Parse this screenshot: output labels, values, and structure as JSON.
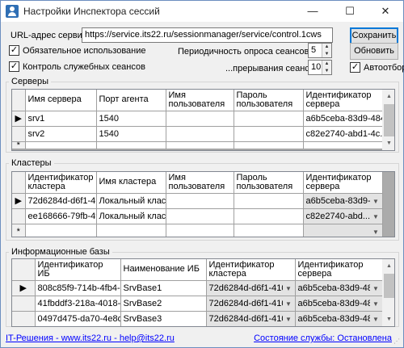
{
  "window": {
    "title": "Настройки Инспектора сессий",
    "minimize": "—",
    "maximize": "☐",
    "close": "✕"
  },
  "form": {
    "url_label": "URL-адрес сервиса:",
    "url_value": "https://service.its22.ru/sessionmanager/service/control.1cws",
    "save_label": "Сохранить",
    "refresh_label": "Обновить",
    "mandatory_label": "Обязательное использование",
    "mandatory_checked": true,
    "service_sessions_label": "Контроль служебных сеансов",
    "service_sessions_checked": true,
    "poll_label": "Периодичность опроса сеансов, сек.:",
    "poll_value": "5",
    "interrupt_label": "...прерывания сеансов:",
    "interrupt_value": "10",
    "autoselect_label": "Автоотбор",
    "autoselect_checked": true
  },
  "servers": {
    "title": "Серверы",
    "columns": [
      "Имя сервера",
      "Порт агента",
      "Имя пользователя",
      "Пароль пользователя",
      "Идентификатор сервера"
    ],
    "rows": [
      [
        "srv1",
        "1540",
        "",
        "",
        "a6b5ceba-83d9-484..."
      ],
      [
        "srv2",
        "1540",
        "",
        "",
        "c82e2740-abd1-4c..."
      ]
    ],
    "current_marker": "▶",
    "new_marker": "*"
  },
  "clusters": {
    "title": "Кластеры",
    "columns": [
      "Идентификатор кластера",
      "Имя кластера",
      "Имя пользователя",
      "Пароль пользователя",
      "Идентификатор сервера"
    ],
    "rows": [
      [
        "72d6284d-d6f1-410...",
        "Локальный класт...",
        "",
        "",
        "a6b5ceba-83d9-484..."
      ],
      [
        "ee168666-79fb-49...",
        "Локальный класт...",
        "",
        "",
        "c82e2740-abd..."
      ]
    ],
    "current_marker": "▶",
    "new_marker": "*"
  },
  "infobases": {
    "title": "Информационные базы",
    "columns": [
      "Идентификатор ИБ",
      "Наименование ИБ",
      "Идентификатор кластера",
      "Идентификатор сервера"
    ],
    "rows": [
      [
        "808c85f9-714b-4fb4-a3...",
        "SrvBase1",
        "72d6284d-d6f1-410...",
        "a6b5ceba-83d9-484..."
      ],
      [
        "41fbddf3-218a-4018-af1...",
        "SrvBase2",
        "72d6284d-d6f1-410...",
        "a6b5ceba-83d9-484..."
      ],
      [
        "0497d475-da70-4e8d-9...",
        "SrvBase3",
        "72d6284d-d6f1-410...",
        "a6b5ceba-83d9-484..."
      ]
    ],
    "current_marker": "▶"
  },
  "status": {
    "link_text": "IT-Решения - www.its22.ru - help@its22.ru",
    "service_state": "Состояние службы: Остановлена"
  },
  "colors": {
    "accent": "#0078d7",
    "link": "#0000ff",
    "grid_bg": "#ababab"
  }
}
